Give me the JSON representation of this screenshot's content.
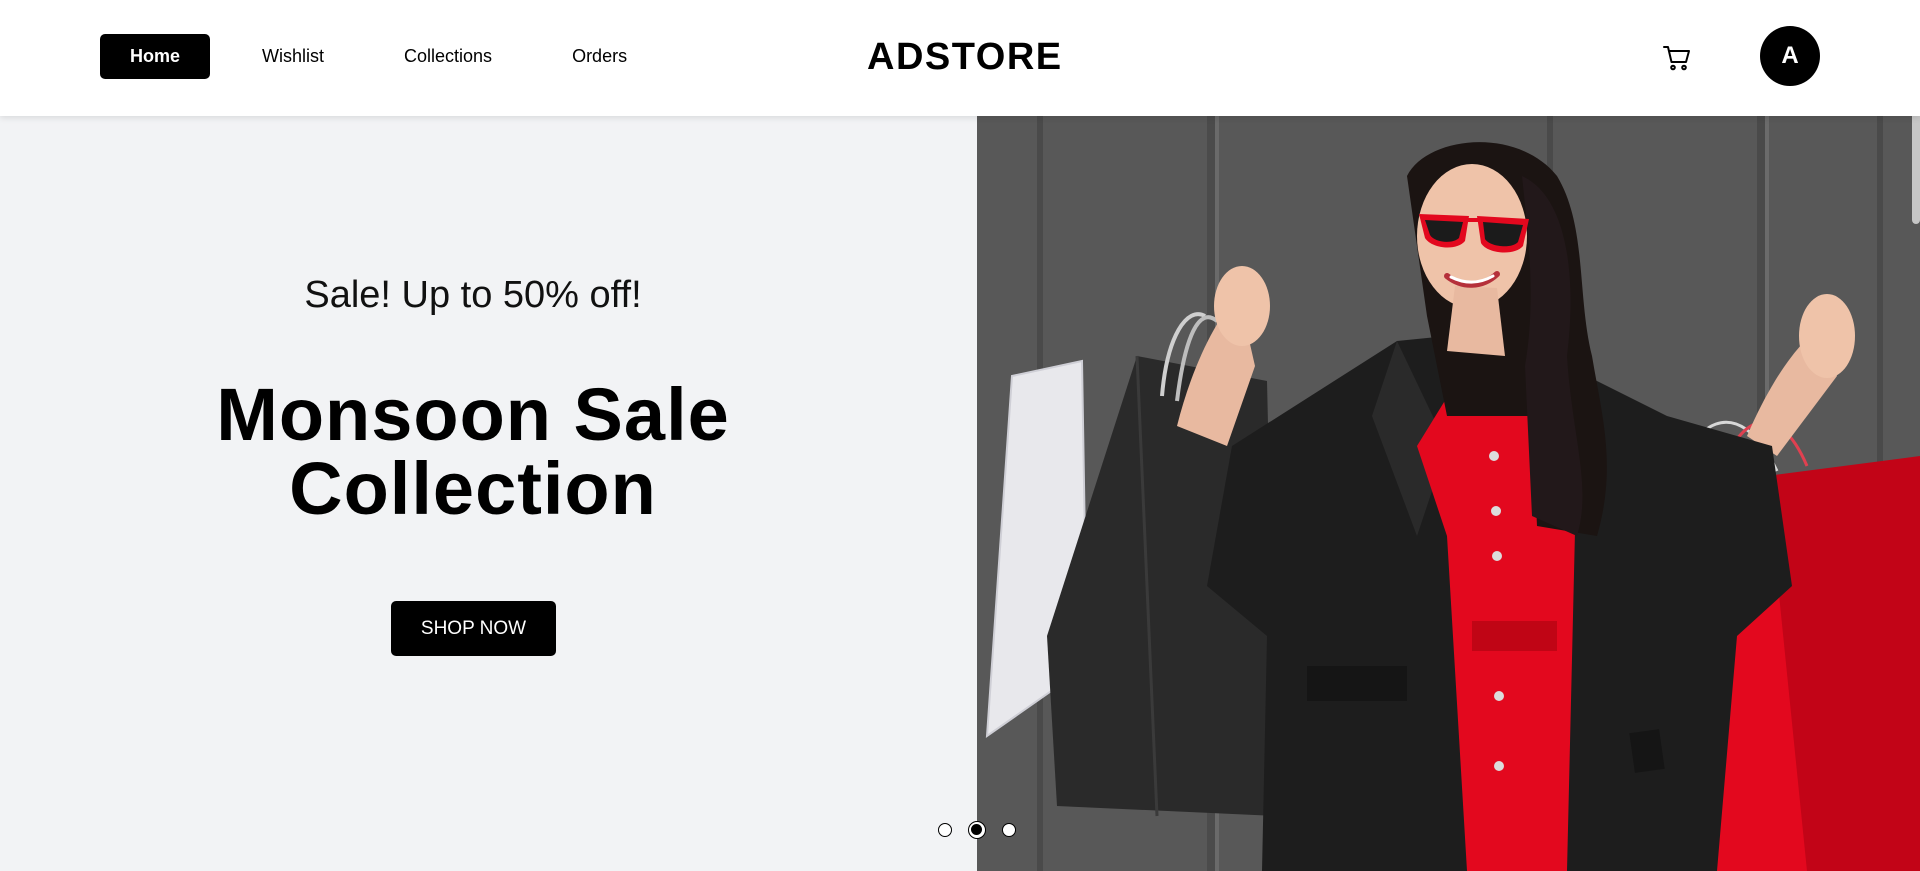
{
  "nav": {
    "links": [
      {
        "label": "Home",
        "active": true
      },
      {
        "label": "Wishlist",
        "active": false
      },
      {
        "label": "Collections",
        "active": false
      },
      {
        "label": "Orders",
        "active": false
      }
    ],
    "brand": "ADSTORE",
    "cart_icon": "cart-icon",
    "avatar_initial": "A"
  },
  "hero": {
    "tagline": "Sale! Up to 50% off!",
    "headline_line1": "Monsoon Sale",
    "headline_line2": "Collection",
    "cta_label": "SHOP NOW",
    "slides_total": 3,
    "active_slide": 2
  },
  "colors": {
    "accent": "#000000",
    "hero_left_bg": "#f2f3f5",
    "image_red": "#e3081e"
  }
}
